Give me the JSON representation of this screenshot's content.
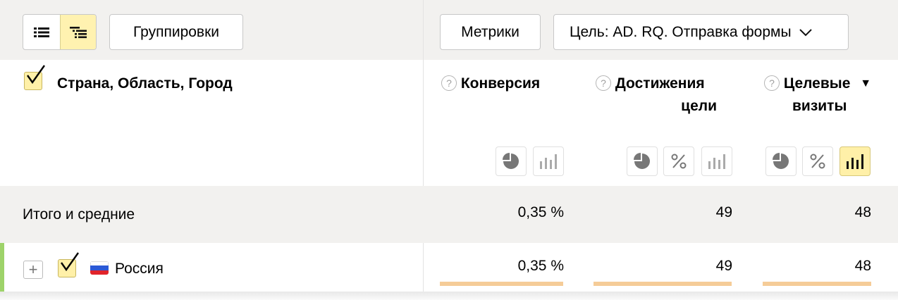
{
  "toolbar": {
    "view_list_icon": "list-icon",
    "view_tree_icon": "tree-list-icon",
    "groupings_label": "Группировки",
    "metrics_label": "Метрики",
    "goal_label": "Цель: AD. RQ. Отправка формы"
  },
  "header": {
    "dimension_title": "Страна, Область, Город",
    "columns": [
      {
        "line1": "Конверсия",
        "line2": ""
      },
      {
        "line1": "Достижения",
        "line2": "цели"
      },
      {
        "line1": "Целевые",
        "line2": "визиты",
        "sort": "▼"
      }
    ],
    "help_glyph": "?"
  },
  "totals": {
    "label": "Итого и средние",
    "values": [
      "0,35 %",
      "49",
      "48"
    ]
  },
  "rows": [
    {
      "label": "Россия",
      "expand_glyph": "+",
      "values": [
        "0,35 %",
        "49",
        "48"
      ],
      "bar_fractions": [
        1,
        1,
        1
      ]
    }
  ],
  "colors": {
    "accent_yellow": "#fff0a8",
    "bar": "#f5cc98",
    "row_marker": "#9ed36a",
    "panel": "#f2f1ef"
  }
}
